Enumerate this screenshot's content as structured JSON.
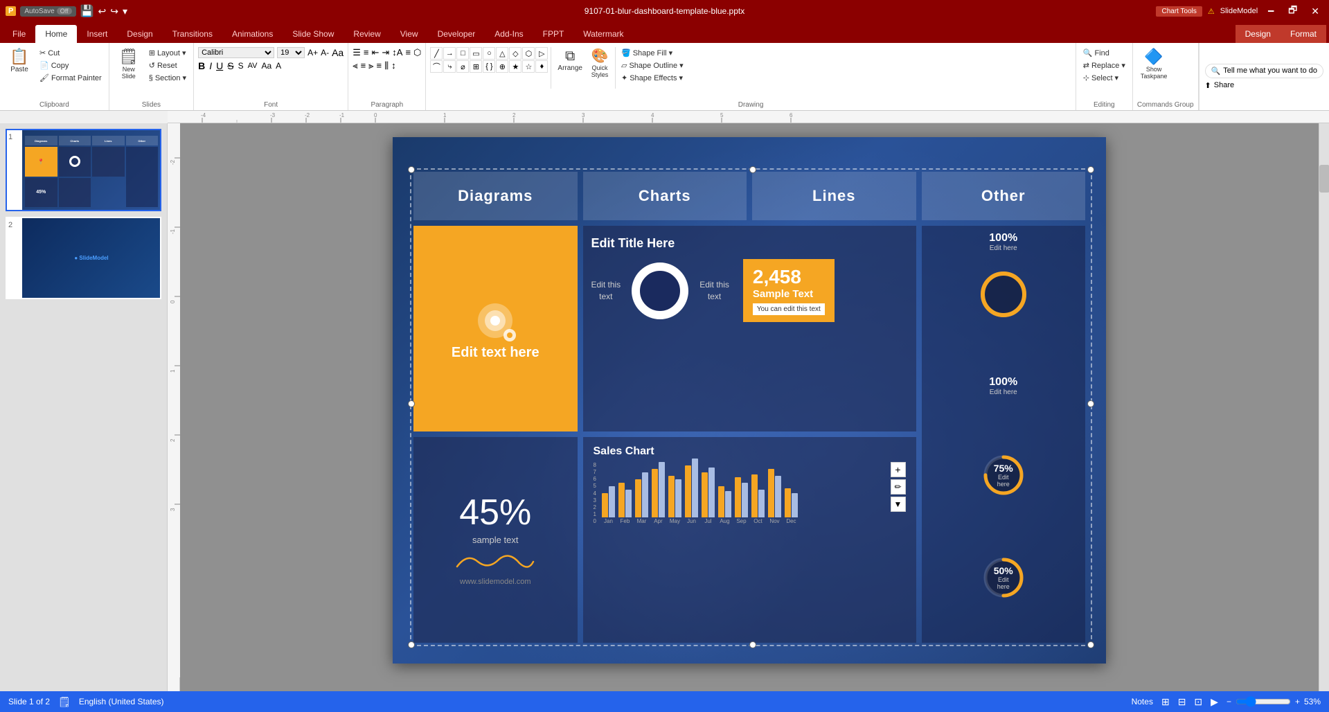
{
  "titlebar": {
    "autosave_label": "AutoSave",
    "autosave_state": "Off",
    "filename": "9107-01-blur-dashboard-template-blue.pptx",
    "chart_tools_label": "Chart Tools",
    "warning_label": "SlideModel",
    "minimize": "🗕",
    "maximize": "🗗",
    "close": "✕"
  },
  "ribbon_tabs": {
    "file": "File",
    "home": "Home",
    "insert": "Insert",
    "design": "Design",
    "transitions": "Transitions",
    "animations": "Animations",
    "slide_show": "Slide Show",
    "review": "Review",
    "view": "View",
    "developer": "Developer",
    "add_ins": "Add-Ins",
    "fppt": "FPPT",
    "watermark": "Watermark",
    "design2": "Design",
    "format": "Format"
  },
  "ribbon": {
    "clipboard_group": "Clipboard",
    "paste_label": "Paste",
    "cut_label": "Cut",
    "copy_label": "Copy",
    "format_painter_label": "Format Painter",
    "slides_group": "Slides",
    "new_slide_label": "New\nSlide",
    "layout_label": "Layout",
    "reset_label": "Reset",
    "section_label": "Section",
    "font_group": "Font",
    "font_name": "Calibri",
    "font_size": "19",
    "bold_label": "B",
    "italic_label": "I",
    "underline_label": "U",
    "strikethrough_label": "S",
    "paragraph_group": "Paragraph",
    "drawing_group": "Drawing",
    "arrange_label": "Arrange",
    "quick_styles_label": "Quick\nStyles",
    "shape_fill_label": "Shape Fill",
    "shape_outline_label": "Shape Outline",
    "shape_effects_label": "Shape Effects",
    "editing_group": "Editing",
    "find_label": "Find",
    "replace_label": "Replace",
    "select_label": "Select",
    "commands_group": "Commands Group",
    "show_taskpane_label": "Show\nTaskpane",
    "tell_me_label": "Tell me what you want to do",
    "share_label": "Share"
  },
  "slide": {
    "headers": [
      "Diagrams",
      "Charts",
      "Lines",
      "Other"
    ],
    "orange_icon": "📍",
    "orange_text": "Edit text here",
    "chart_title": "Edit Title Here",
    "edit_left": "Edit this\ntext",
    "edit_right": "Edit this\ntext",
    "number_big": "2,458",
    "number_label": "Sample Text",
    "number_sub": "You can edit this text",
    "sales_title": "Sales Chart",
    "big_pct": "45%",
    "sample_text": "sample text",
    "website": "www.slidemodel.com",
    "pct1": "100%",
    "pct1_sub": "Edit here",
    "pct2": "75%",
    "pct2_sub": "Edit here",
    "pct3": "50%",
    "pct3_sub": "Edit here",
    "months": [
      "Jan",
      "Feb",
      "Mar",
      "Apr",
      "May",
      "Jun",
      "Jul",
      "Aug",
      "Sep",
      "Oct",
      "Nov",
      "Dec"
    ],
    "y_axis": [
      "8",
      "7",
      "6",
      "5",
      "4",
      "3",
      "2",
      "1",
      "0"
    ]
  },
  "statusbar": {
    "slide_info": "Slide 1 of 2",
    "language": "English (United States)",
    "notes_label": "Notes",
    "zoom": "53%"
  }
}
